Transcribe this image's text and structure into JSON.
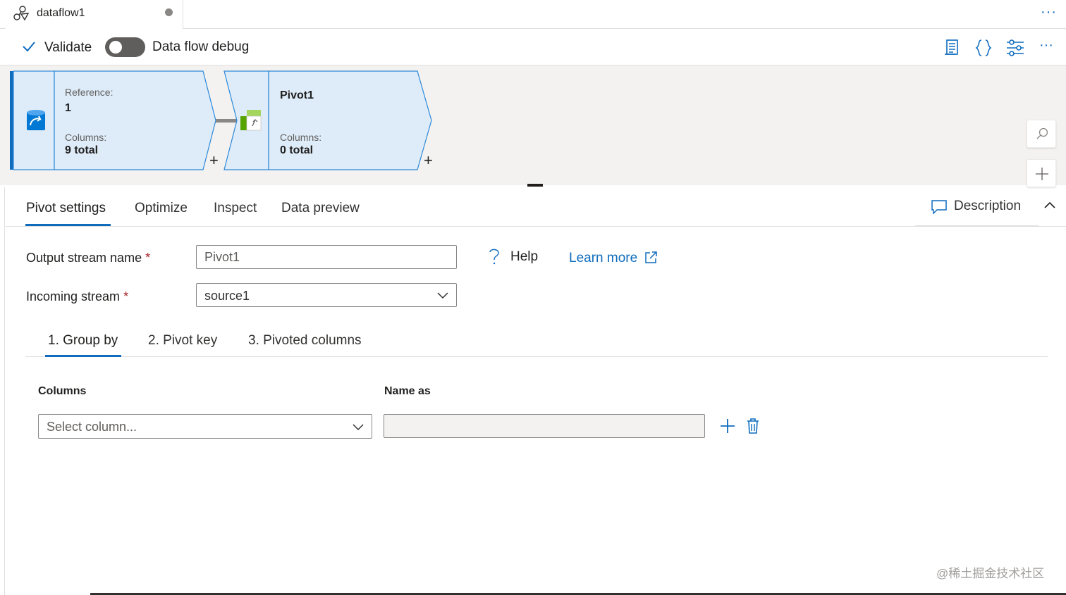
{
  "doc_tab": {
    "title": "dataflow1",
    "icon": "dataflow-icon",
    "unsaved": true
  },
  "top_more": "···",
  "toolbar": {
    "validate_label": "Validate",
    "debug_label": "Data flow debug",
    "debug_on": false,
    "more": "···",
    "right_icons": [
      "script-icon",
      "code-icon",
      "settings-sliders-icon",
      "more-icon"
    ]
  },
  "canvas": {
    "source_node": {
      "reference_label": "Reference:",
      "reference_value": "1",
      "columns_label": "Columns:",
      "columns_value": "9 total",
      "add": "+"
    },
    "pivot_node": {
      "name": "Pivot1",
      "columns_label": "Columns:",
      "columns_value": "0 total",
      "add": "+"
    },
    "side_buttons": [
      "search-icon",
      "plus-icon"
    ]
  },
  "panel": {
    "tabs": [
      {
        "label": "Pivot settings",
        "active": true
      },
      {
        "label": "Optimize",
        "active": false
      },
      {
        "label": "Inspect",
        "active": false
      },
      {
        "label": "Data preview",
        "active": false
      }
    ],
    "description_label": "Description"
  },
  "form": {
    "output_label": "Output stream name",
    "output_value": "Pivot1",
    "incoming_label": "Incoming stream",
    "incoming_value": "source1",
    "required_mark": "*",
    "help_label": "Help",
    "learn_more_label": "Learn more"
  },
  "pivot_steps": {
    "tabs": [
      {
        "label": "1. Group by",
        "active": true
      },
      {
        "label": "2. Pivot key",
        "active": false
      },
      {
        "label": "3. Pivoted columns",
        "active": false
      }
    ],
    "columns_header": "Columns",
    "name_as_header": "Name as",
    "column_placeholder": "Select column...",
    "name_as_value": ""
  },
  "watermark": "@稀土掘金技术社区",
  "colors": {
    "accent": "#0f6cbd",
    "canvas_bg": "#f3f2f1",
    "node_fill": "#deecf9",
    "node_border": "#2b88d8",
    "required": "#a4262c"
  }
}
